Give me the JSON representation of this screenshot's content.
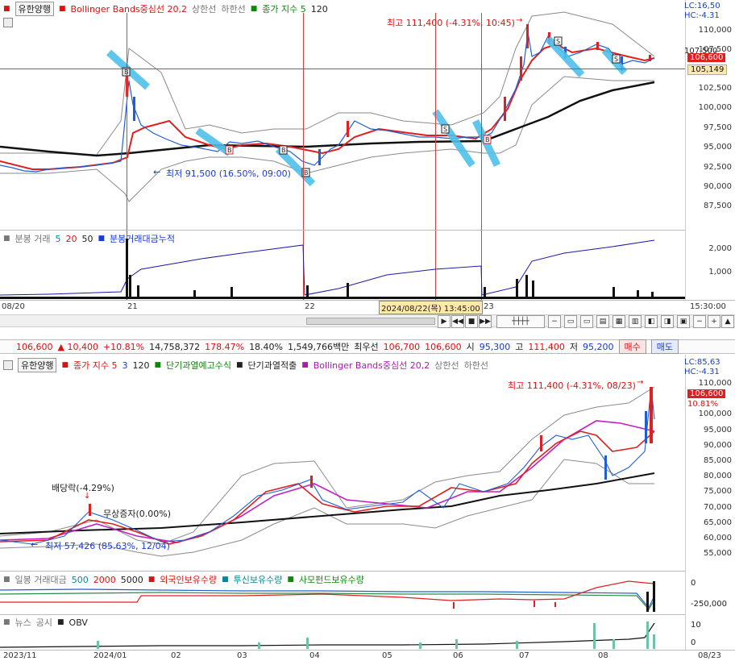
{
  "top_chart": {
    "toolbar": {
      "item1": "유한양행",
      "item2": "Bollinger Bands중심선 20,2",
      "item3": "상한선",
      "item4": "하한선",
      "item5": "종가 지수 5",
      "item6": "120"
    },
    "lc": "LC:16,50",
    "hc": "HC:-4.31",
    "y_ticks": [
      "110,000",
      "107,500",
      "105,000",
      "102,500",
      "100,000",
      "97,500",
      "95,000",
      "92,500",
      "90,000",
      "87,500"
    ],
    "price_current": "106,600",
    "price_ref": "105,149",
    "annotation_high": "최고 111,400 (-4.31%, 10:45)",
    "annotation_low": "최저 91,500 (16.50%, 09:00)",
    "signal_b": "B",
    "signal_s": "S",
    "volume_toolbar": {
      "l1": "분봉 거래",
      "l2": "5",
      "l3": "20",
      "l4": "50",
      "l5": "분봉거래대금누적"
    },
    "vol_ticks": [
      "2,000",
      "1,000"
    ],
    "x_labels": [
      "08/20",
      "21",
      "22",
      "23"
    ],
    "cursor_time": "2024/08/22(목) 13:45:00",
    "time_label": "15:30:00"
  },
  "quote_bar": {
    "price": "106,600",
    "change": "▲ 10,400",
    "pct": "+10.81%",
    "volume": "14,758,372",
    "ratio": "178.47%",
    "turnover": "18.40%",
    "amount": "1,549,766백만",
    "ask_label": "최우선",
    "ask": "106,700",
    "bid": "106,600",
    "open_label": "시",
    "open": "95,300",
    "high_label": "고",
    "high": "111,400",
    "low_label": "저",
    "low": "95,200",
    "buy": "매수",
    "sell": "매도"
  },
  "bottom_chart": {
    "toolbar": {
      "item1": "유한양행",
      "item2": "종가 지수 5",
      "item3": "3",
      "item4": "120",
      "item5": "단기과열예고수식",
      "item6": "단기과열적출",
      "item7": "Bollinger Bands중심선 20,2",
      "item8": "상한선",
      "item9": "하한선"
    },
    "lc": "LC:85,63",
    "hc": "HC:-4.31",
    "y_ticks": [
      "110,000",
      "105,000",
      "100,000",
      "95,000",
      "90,000",
      "85,000",
      "80,000",
      "75,000",
      "70,000",
      "65,000",
      "60,000",
      "55,000"
    ],
    "price_current": "106,600",
    "pct_current": "10.81%",
    "annotation_high": "최고 111,400 (-4.31%, 08/23)",
    "annotation_low": "최저 57,426 (85.63%, 12/04)",
    "annotation_div": "배당락(-4.29%)",
    "annotation_bonus": "무상증자(0.00%)",
    "vol_toolbar": {
      "l1": "일봉 거래대금",
      "l2": "500",
      "l3": "2000",
      "l4": "5000",
      "l5": "외국인보유수량",
      "l6": "투신보유수량",
      "l7": "사모펀드보유수량"
    },
    "vol_ticks": [
      "0",
      "-250,000"
    ],
    "obv_toolbar": {
      "l1": "뉴스",
      "l2": "공시",
      "l3": "OBV"
    },
    "obv_ticks": [
      "10",
      "0"
    ],
    "x_labels": [
      "2023/11",
      "2024/01",
      "02",
      "03",
      "04",
      "05",
      "06",
      "07",
      "08"
    ],
    "time_label": "08/23"
  },
  "colors": {
    "up": "#e02020",
    "down": "#1f5fd1",
    "bb": "#8a8a8a",
    "ma120": "#111111",
    "ma5": "#e02020",
    "bbmid": "#c020c0"
  }
}
